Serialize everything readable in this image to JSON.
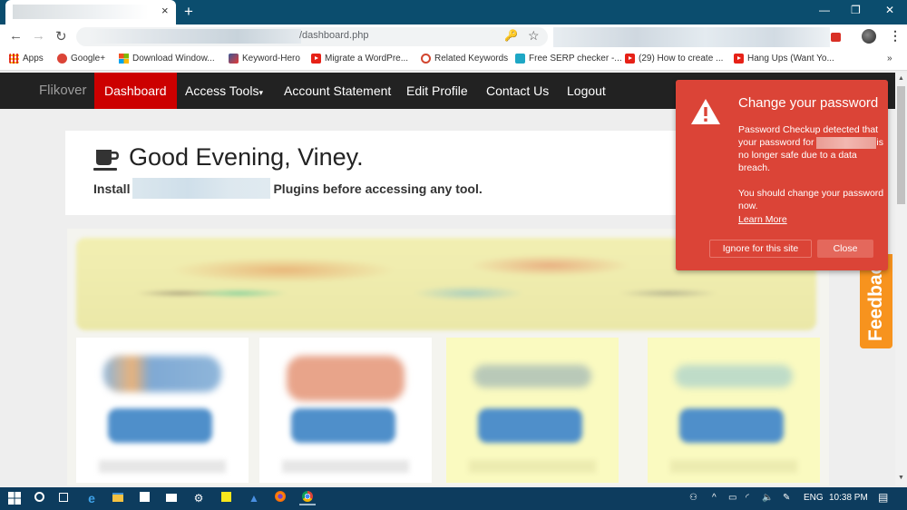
{
  "browser": {
    "tab_close_glyph": "×",
    "new_tab_glyph": "+",
    "window_controls": {
      "minimize": "—",
      "restore": "❐",
      "close": "✕"
    },
    "nav": {
      "back": "←",
      "forward": "→",
      "reload": "↻"
    },
    "url_visible": "/dashboard.php",
    "key_icon": "🔑",
    "star_icon": "☆",
    "menu": "⋮",
    "bookmarks": [
      {
        "label": "Apps",
        "icon": "apps-grid"
      },
      {
        "label": "Google+",
        "icon": "google-plus"
      },
      {
        "label": "Download Window...",
        "icon": "windows"
      },
      {
        "label": "Keyword-Hero",
        "icon": "keyword-hero"
      },
      {
        "label": "Migrate a WordPre...",
        "icon": "youtube"
      },
      {
        "label": "Related Keywords",
        "icon": "circle"
      },
      {
        "label": "Free SERP checker -...",
        "icon": "serp"
      },
      {
        "label": "(29) How to create ...",
        "icon": "youtube"
      },
      {
        "label": "Hang Ups (Want Yo...",
        "icon": "youtube"
      }
    ],
    "bookmarks_overflow": "»"
  },
  "site": {
    "brand": "Flikover",
    "nav": [
      "Dashboard",
      "Access Tools",
      "Account Statement",
      "Edit Profile",
      "Contact Us",
      "Logout"
    ],
    "dropdown_caret": "▾",
    "greeting": "Good Evening, Viney.",
    "install_prefix": "Install",
    "install_suffix": "Plugins before accessing any tool.",
    "feedback": "Feedback"
  },
  "password_popup": {
    "title": "Change your password",
    "body_line1": "Password Checkup detected that your password for",
    "body_line2": "is no longer safe due to a data breach.",
    "body_line3": "You should change your password now.",
    "learn_more": "Learn More",
    "ignore_button": "Ignore for this site",
    "close_button": "Close"
  },
  "taskbar": {
    "language": "ENG",
    "time": "10:38 PM"
  }
}
